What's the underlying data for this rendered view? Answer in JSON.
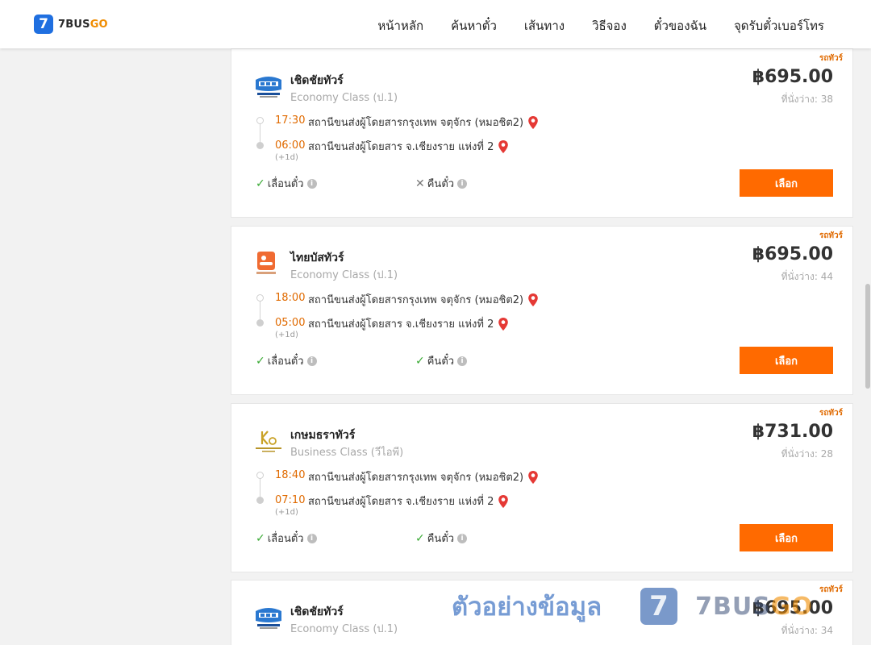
{
  "brand": {
    "logo_mark": "7",
    "logo_text": "7BUS",
    "logo_text_go": "GO"
  },
  "nav": [
    "หน้าหลัก",
    "ค้นหาตั๋ว",
    "เส้นทาง",
    "วิธีจอง",
    "ตั๋วของฉัน",
    "จุดรับตั๋วเบอร์โทร"
  ],
  "cards": [
    {
      "tag": "รถทัวร์",
      "operator": "เชิดชัยทัวร์",
      "class": "Economy Class (ป.1)",
      "price": "฿695.00",
      "seats": "ที่นั่งว่าง: 38",
      "depart_time": "17:30",
      "depart_station": "สถานีขนส่งผู้โดยสารกรุงเทพ จตุจักร (หมอชิต2)",
      "arrive_time": "06:00",
      "arrive_station": "สถานีขนส่งผู้โดยสาร จ.เชียงราย แห่งที่ 2",
      "next_day": "(+1d)",
      "feature1": "เลื่อนตั๋ว",
      "feature1_ok": true,
      "feature2": "คืนตั๋ว",
      "feature2_ok": false,
      "button": "เลือก",
      "logo": "cherdchai-bus-icon"
    },
    {
      "tag": "รถทัวร์",
      "operator": "ไทยบัสทัวร์",
      "class": "Economy Class (ป.1)",
      "price": "฿695.00",
      "seats": "ที่นั่งว่าง: 44",
      "depart_time": "18:00",
      "depart_station": "สถานีขนส่งผู้โดยสารกรุงเทพ จตุจักร (หมอชิต2)",
      "arrive_time": "05:00",
      "arrive_station": "สถานีขนส่งผู้โดยสาร จ.เชียงราย แห่งที่ 2",
      "next_day": "(+1d)",
      "feature1": "เลื่อนตั๋ว",
      "feature1_ok": true,
      "feature2": "คืนตั๋ว",
      "feature2_ok": true,
      "button": "เลือก",
      "logo": "thai-bus-icon"
    },
    {
      "tag": "รถทัวร์",
      "operator": "เกษมธราทัวร์",
      "class": "Business Class (วีไอพี)",
      "price": "฿731.00",
      "seats": "ที่นั่งว่าง: 28",
      "depart_time": "18:40",
      "depart_station": "สถานีขนส่งผู้โดยสารกรุงเทพ จตุจักร (หมอชิต2)",
      "arrive_time": "07:10",
      "arrive_station": "สถานีขนส่งผู้โดยสาร จ.เชียงราย แห่งที่ 2",
      "next_day": "(+1d)",
      "feature1": "เลื่อนตั๋ว",
      "feature1_ok": true,
      "feature2": "คืนตั๋ว",
      "feature2_ok": true,
      "button": "เลือก",
      "logo": "kasemthara-icon"
    },
    {
      "tag": "รถทัวร์",
      "operator": "เชิดชัยทัวร์",
      "class": "Economy Class (ป.1)",
      "price": "฿695.00",
      "seats": "ที่นั่งว่าง: 34",
      "logo": "cherdchai-bus-icon"
    }
  ],
  "watermark": {
    "text": "ตัวอย่างข้อมูล",
    "mark": "7",
    "brand": "7BUS",
    "brand_go": "GO"
  },
  "colors": {
    "accent": "#ff6a00",
    "time": "#e06a00",
    "check": "#3aaa35",
    "pin": "#e53935"
  }
}
